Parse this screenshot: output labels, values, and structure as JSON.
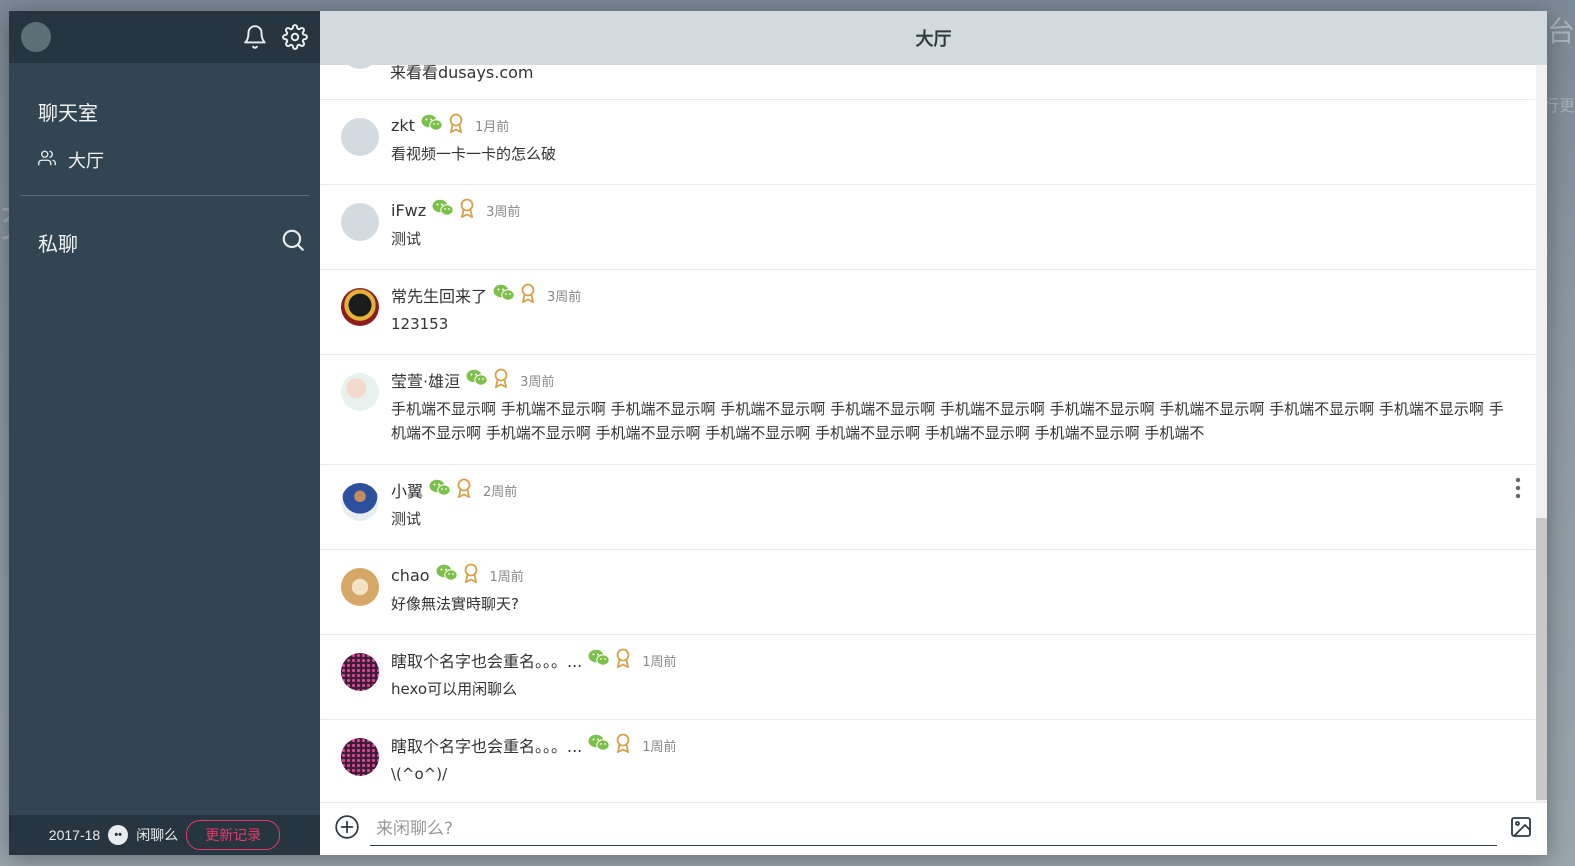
{
  "backdrop": {
    "text_top_right": "台",
    "text_mid_right": "行更",
    "text_left": "交",
    "text_left2": "欢"
  },
  "sidebar": {
    "chatroom_title": "聊天室",
    "rooms": [
      {
        "label": "大厅",
        "icon": "users-icon"
      }
    ],
    "private_title": "私聊",
    "footer": {
      "year": "2017-18",
      "app_name": "闲聊么",
      "update_button": "更新记录"
    }
  },
  "header": {
    "title": "大厅"
  },
  "partial_message": {
    "text": "来看看dusays.com"
  },
  "messages": [
    {
      "user": "zkt",
      "time": "1月前",
      "text": "看视频一卡一卡的怎么破"
    },
    {
      "user": "iFwz",
      "time": "3周前",
      "text": "测试"
    },
    {
      "user": "常先生回来了",
      "time": "3周前",
      "text": "123153"
    },
    {
      "user": "莹萱·雄洹",
      "time": "3周前",
      "text": "手机端不显示啊 手机端不显示啊 手机端不显示啊 手机端不显示啊 手机端不显示啊 手机端不显示啊 手机端不显示啊 手机端不显示啊 手机端不显示啊 手机端不显示啊 手机端不显示啊 手机端不显示啊 手机端不显示啊 手机端不显示啊 手机端不显示啊 手机端不显示啊 手机端不显示啊 手机端不"
    },
    {
      "user": "小翼",
      "time": "2周前",
      "text": "测试"
    },
    {
      "user": "chao",
      "time": "1周前",
      "text": "好像無法實時聊天?"
    },
    {
      "user": "瞎取个名字也会重名。。。...",
      "time": "1周前",
      "text": "hexo可以用闲聊么"
    },
    {
      "user": "瞎取个名字也会重名。。。...",
      "time": "1周前",
      "text": "\\(^o^)/"
    }
  ],
  "composer": {
    "placeholder": "来闲聊么?"
  },
  "colors": {
    "sidebar": "#324552",
    "sidebar_dark": "#263540",
    "header": "#d2dadf",
    "wechat": "#7cc04b",
    "medal": "#d5a24a",
    "accent": "#e23c6a"
  }
}
